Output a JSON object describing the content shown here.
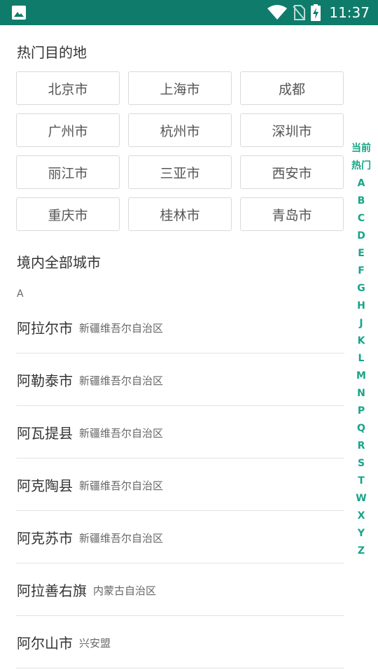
{
  "status_bar": {
    "time": "11:37",
    "background": "#0f7c6b",
    "icons": [
      "image-icon",
      "wifi-icon",
      "no-sim-icon",
      "battery-charging-icon"
    ]
  },
  "hot_section": {
    "title": "热门目的地",
    "cities": [
      "北京市",
      "上海市",
      "成都",
      "广州市",
      "杭州市",
      "深圳市",
      "丽江市",
      "三亚市",
      "西安市",
      "重庆市",
      "桂林市",
      "青岛市"
    ]
  },
  "all_section": {
    "title": "境内全部城市",
    "letter": "A",
    "cities": [
      {
        "name": "阿拉尔市",
        "region": "新疆维吾尔自治区"
      },
      {
        "name": "阿勒泰市",
        "region": "新疆维吾尔自治区"
      },
      {
        "name": "阿瓦提县",
        "region": "新疆维吾尔自治区"
      },
      {
        "name": "阿克陶县",
        "region": "新疆维吾尔自治区"
      },
      {
        "name": "阿克苏市",
        "region": "新疆维吾尔自治区"
      },
      {
        "name": "阿拉善右旗",
        "region": "内蒙古自治区"
      },
      {
        "name": "阿尔山市",
        "region": "兴安盟"
      }
    ]
  },
  "index_bar": {
    "items": [
      "当前",
      "热门",
      "A",
      "B",
      "C",
      "D",
      "E",
      "F",
      "G",
      "H",
      "J",
      "K",
      "L",
      "M",
      "N",
      "P",
      "Q",
      "R",
      "S",
      "T",
      "W",
      "X",
      "Y",
      "Z"
    ],
    "color": "#17a589"
  }
}
